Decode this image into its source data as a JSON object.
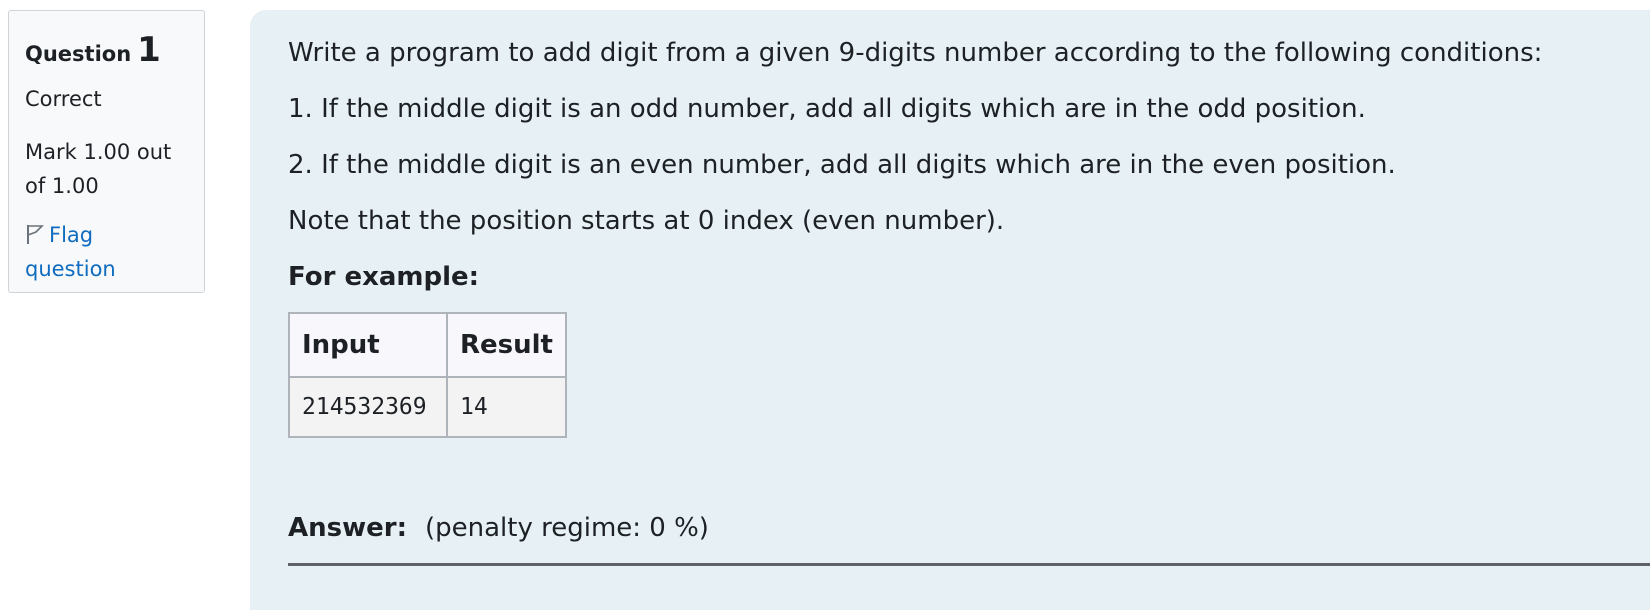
{
  "info": {
    "question_label": "Question",
    "question_number": "1",
    "state": "Correct",
    "grade": "Mark 1.00 out of 1.00",
    "flag_label": "Flag question"
  },
  "question": {
    "intro": "Write a program to add digit from a given 9-digits number according to the following conditions:",
    "condition_1": "1. If the middle digit is an odd number, add all digits which are in the odd position.",
    "condition_2": "2. If the middle digit is an even number, add all digits which are in the even position.",
    "note": "Note that the position starts at 0 index (even number).",
    "example_heading": "For example:",
    "table": {
      "headers": [
        "Input",
        "Result"
      ],
      "rows": [
        [
          "214532369",
          "14"
        ]
      ]
    }
  },
  "answer": {
    "label": "Answer:",
    "penalty": "(penalty regime: 0 %)"
  },
  "colors": {
    "link": "#0f6cbf",
    "panel_bg": "#e7f1f5",
    "info_bg": "#f8f9fa"
  }
}
